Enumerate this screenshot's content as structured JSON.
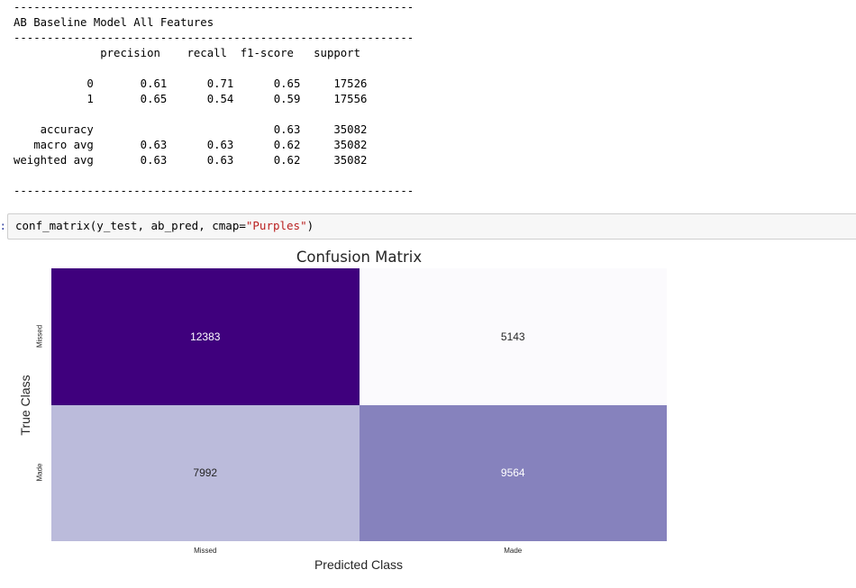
{
  "report": {
    "separator": "------------------------------------------------------------",
    "title": "AB Baseline Model All Features",
    "header": "             precision    recall  f1-score   support",
    "rows": [
      "           0       0.61      0.71      0.65     17526",
      "           1       0.65      0.54      0.59     17556",
      "",
      "    accuracy                           0.63     35082",
      "   macro avg       0.63      0.63      0.62     35082",
      "weighted avg       0.63      0.63      0.62     35082"
    ]
  },
  "cell": {
    "prompt_fragment": "]:",
    "code_prefix": "conf_matrix(y_test, ab_pred, cmap=",
    "code_string": "\"Purples\"",
    "code_suffix": ")"
  },
  "chart_data": {
    "type": "heatmap",
    "title": "Confusion Matrix",
    "xlabel": "Predicted Class",
    "ylabel": "True Class",
    "x_categories": [
      "Missed",
      "Made"
    ],
    "y_categories": [
      "Missed",
      "Made"
    ],
    "values": [
      [
        12383,
        5143
      ],
      [
        7992,
        9564
      ]
    ],
    "colormap": "Purples",
    "cell_colors": [
      [
        "#3f007d",
        "#fbfafd"
      ],
      [
        "#bbbbdb",
        "#8682bd"
      ]
    ],
    "text_colors": [
      [
        "#ffffff",
        "#262626"
      ],
      [
        "#262626",
        "#ffffff"
      ]
    ]
  }
}
